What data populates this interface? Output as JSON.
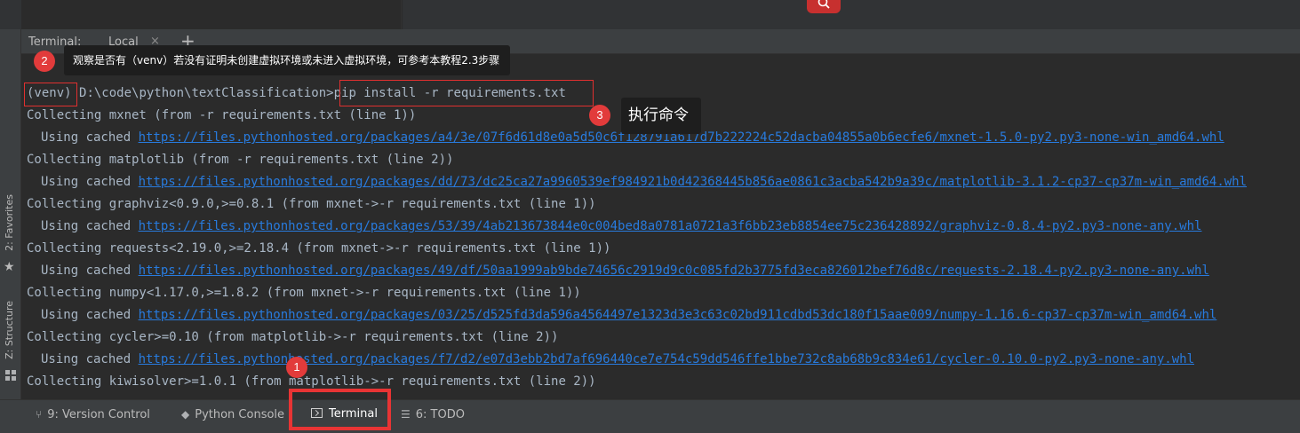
{
  "terminal": {
    "title": "Terminal:",
    "tab_label": "Local",
    "tab_close": "×",
    "add_label": "+"
  },
  "sidebar": {
    "favorites_label": "2: Favorites",
    "structure_label": "Z: Structure"
  },
  "prompt": {
    "venv": "(venv)",
    "path": "D:\\code\\python\\textClassification>",
    "command": "pip install -r requirements.txt"
  },
  "output": [
    {
      "kind": "collect",
      "text": "Collecting mxnet (from -r requirements.txt (line 1))"
    },
    {
      "kind": "cached",
      "prefix": "Using cached ",
      "url": "https://files.pythonhosted.org/packages/a4/3e/07f6d61d8e0a5d50c6f128791a617d7b222224c52dacba04855a0b6ecfe6/mxnet-1.5.0-py2.py3-none-win_amd64.whl"
    },
    {
      "kind": "collect",
      "text": "Collecting matplotlib (from -r requirements.txt (line 2))"
    },
    {
      "kind": "cached",
      "prefix": "Using cached ",
      "url": "https://files.pythonhosted.org/packages/dd/73/dc25ca27a9960539ef984921b0d42368445b856ae0861c3acba542b9a39c/matplotlib-3.1.2-cp37-cp37m-win_amd64.whl"
    },
    {
      "kind": "collect",
      "text": "Collecting graphviz<0.9.0,>=0.8.1 (from mxnet->-r requirements.txt (line 1))"
    },
    {
      "kind": "cached",
      "prefix": "Using cached ",
      "url": "https://files.pythonhosted.org/packages/53/39/4ab213673844e0c004bed8a0781a0721a3f6bb23eb8854ee75c236428892/graphviz-0.8.4-py2.py3-none-any.whl"
    },
    {
      "kind": "collect",
      "text": "Collecting requests<2.19.0,>=2.18.4 (from mxnet->-r requirements.txt (line 1))"
    },
    {
      "kind": "cached",
      "prefix": "Using cached ",
      "url": "https://files.pythonhosted.org/packages/49/df/50aa1999ab9bde74656c2919d9c0c085fd2b3775fd3eca826012bef76d8c/requests-2.18.4-py2.py3-none-any.whl"
    },
    {
      "kind": "collect",
      "text": "Collecting numpy<1.17.0,>=1.8.2 (from mxnet->-r requirements.txt (line 1))"
    },
    {
      "kind": "cached",
      "prefix": "Using cached ",
      "url": "https://files.pythonhosted.org/packages/03/25/d525fd3da596a4564497e1323d3e3c63c02bd911cdbd53dc180f15aae009/numpy-1.16.6-cp37-cp37m-win_amd64.whl"
    },
    {
      "kind": "collect",
      "text": "Collecting cycler>=0.10 (from matplotlib->-r requirements.txt (line 2))"
    },
    {
      "kind": "cached",
      "prefix": "Using cached ",
      "url": "https://files.pythonhosted.org/packages/f7/d2/e07d3ebb2bd7af696440ce7e754c59dd546ffe1bbe732c8ab68b9c834e61/cycler-0.10.0-py2.py3-none-any.whl"
    },
    {
      "kind": "collect",
      "text": "Collecting kiwisolver>=1.0.1 (from matplotlib->-r requirements.txt (line 2))"
    }
  ],
  "annotations": {
    "badge1": "1",
    "badge2": "2",
    "badge3": "3",
    "callout2": "观察是否有（venv）若没有证明未创建虚拟环境或未进入虚拟环境，可参考本教程2.3步骤",
    "callout3": "执行命令"
  },
  "bottom_bar": {
    "version_control": "9: Version Control",
    "python_console": "Python Console",
    "terminal": "Terminal",
    "todo": "6: TODO"
  },
  "colors": {
    "background": "#2b2b2b",
    "text": "#a9b7c6",
    "link": "#287bde",
    "annotation_red": "#e0302f",
    "callout_bg": "#1e1e1e"
  }
}
